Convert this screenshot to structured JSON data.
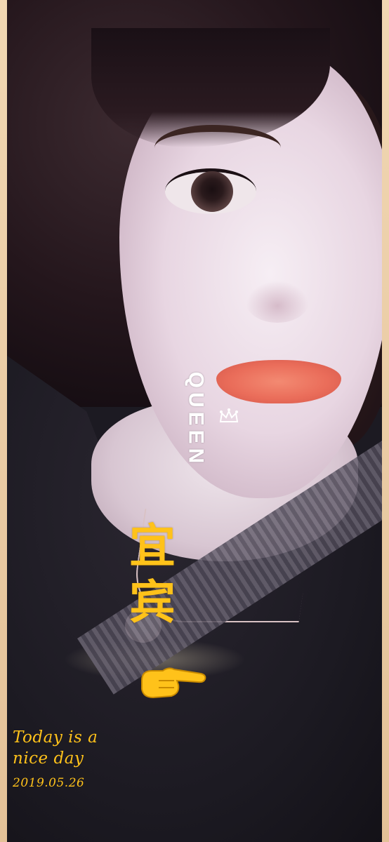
{
  "overlay": {
    "queen_label": "QUEEN",
    "name_text": "宜宾",
    "caption_line1": "Today is a",
    "caption_line2": "nice day",
    "date": "2019.05.26"
  },
  "icons": {
    "crown": "crown-icon",
    "pointing_hand": "pointing-hand-icon"
  },
  "colors": {
    "text_accent": "#ffc21a",
    "frame": "#e8c9a0",
    "lips": "#ea6d5a"
  }
}
